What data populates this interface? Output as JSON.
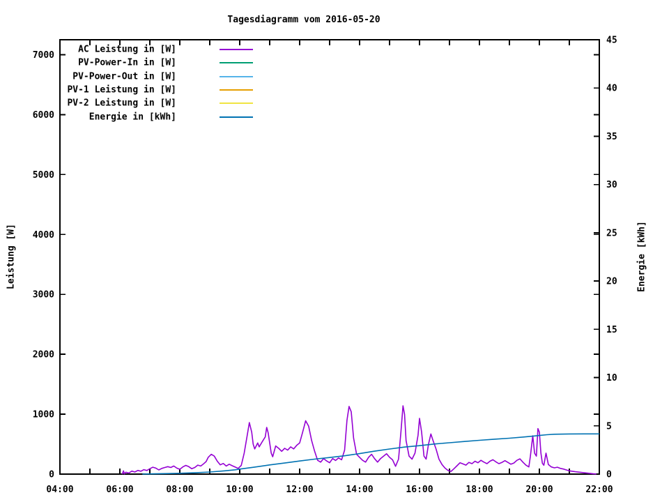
{
  "chart_data": {
    "type": "line",
    "title": "Tagesdiagramm vom 2016-05-20",
    "x_axis": {
      "start_hour": 4,
      "end_hour": 22,
      "tick_step_hours": 1,
      "label_hours": [
        4,
        6,
        8,
        10,
        12,
        14,
        16,
        18,
        20,
        22
      ],
      "labels": [
        "04:00",
        "06:00",
        "08:00",
        "10:00",
        "12:00",
        "14:00",
        "16:00",
        "18:00",
        "20:00",
        "22:00"
      ]
    },
    "y_left": {
      "label": "Leistung [W]",
      "tick_values": [
        0,
        1000,
        2000,
        3000,
        4000,
        5000,
        6000,
        7000
      ],
      "top_value": 7250
    },
    "y_right": {
      "label": "Energie [kWh]",
      "tick_values": [
        0,
        5,
        10,
        15,
        20,
        25,
        30,
        35,
        40,
        45
      ],
      "top_value": 45
    },
    "grid": false,
    "legend_position": "top-left-inside",
    "series": [
      {
        "name": "AC Leistung in [W]",
        "color": "#9400d3",
        "axis": "left",
        "points": [
          [
            6.08,
            0
          ],
          [
            6.12,
            55
          ],
          [
            6.15,
            5
          ],
          [
            6.2,
            32
          ],
          [
            6.3,
            18
          ],
          [
            6.4,
            50
          ],
          [
            6.5,
            35
          ],
          [
            6.6,
            62
          ],
          [
            6.7,
            48
          ],
          [
            6.8,
            75
          ],
          [
            6.9,
            60
          ],
          [
            7.0,
            90
          ],
          [
            7.1,
            115
          ],
          [
            7.2,
            100
          ],
          [
            7.3,
            70
          ],
          [
            7.4,
            95
          ],
          [
            7.5,
            110
          ],
          [
            7.6,
            125
          ],
          [
            7.7,
            110
          ],
          [
            7.8,
            135
          ],
          [
            7.9,
            100
          ],
          [
            8.0,
            80
          ],
          [
            8.1,
            120
          ],
          [
            8.2,
            145
          ],
          [
            8.3,
            125
          ],
          [
            8.4,
            90
          ],
          [
            8.5,
            110
          ],
          [
            8.6,
            150
          ],
          [
            8.7,
            135
          ],
          [
            8.78,
            165
          ],
          [
            8.88,
            210
          ],
          [
            8.95,
            280
          ],
          [
            9.05,
            330
          ],
          [
            9.15,
            300
          ],
          [
            9.25,
            215
          ],
          [
            9.35,
            155
          ],
          [
            9.45,
            178
          ],
          [
            9.55,
            135
          ],
          [
            9.65,
            165
          ],
          [
            9.75,
            140
          ],
          [
            9.85,
            118
          ],
          [
            9.95,
            95
          ],
          [
            10.05,
            145
          ],
          [
            10.15,
            350
          ],
          [
            10.25,
            650
          ],
          [
            10.32,
            860
          ],
          [
            10.4,
            700
          ],
          [
            10.45,
            500
          ],
          [
            10.5,
            420
          ],
          [
            10.6,
            520
          ],
          [
            10.65,
            455
          ],
          [
            10.75,
            540
          ],
          [
            10.85,
            620
          ],
          [
            10.9,
            780
          ],
          [
            10.95,
            690
          ],
          [
            11.05,
            350
          ],
          [
            11.1,
            290
          ],
          [
            11.2,
            470
          ],
          [
            11.3,
            430
          ],
          [
            11.4,
            380
          ],
          [
            11.5,
            430
          ],
          [
            11.6,
            400
          ],
          [
            11.7,
            455
          ],
          [
            11.8,
            420
          ],
          [
            11.9,
            480
          ],
          [
            12.0,
            520
          ],
          [
            12.1,
            700
          ],
          [
            12.2,
            890
          ],
          [
            12.3,
            800
          ],
          [
            12.4,
            560
          ],
          [
            12.5,
            380
          ],
          [
            12.6,
            230
          ],
          [
            12.7,
            200
          ],
          [
            12.8,
            260
          ],
          [
            12.9,
            220
          ],
          [
            13.0,
            190
          ],
          [
            13.1,
            260
          ],
          [
            13.2,
            228
          ],
          [
            13.3,
            270
          ],
          [
            13.4,
            240
          ],
          [
            13.5,
            400
          ],
          [
            13.58,
            900
          ],
          [
            13.65,
            1130
          ],
          [
            13.72,
            1040
          ],
          [
            13.8,
            600
          ],
          [
            13.9,
            330
          ],
          [
            14.0,
            280
          ],
          [
            14.1,
            230
          ],
          [
            14.2,
            200
          ],
          [
            14.3,
            280
          ],
          [
            14.4,
            330
          ],
          [
            14.5,
            258
          ],
          [
            14.6,
            200
          ],
          [
            14.7,
            260
          ],
          [
            14.8,
            300
          ],
          [
            14.9,
            340
          ],
          [
            15.0,
            280
          ],
          [
            15.1,
            238
          ],
          [
            15.2,
            130
          ],
          [
            15.3,
            250
          ],
          [
            15.38,
            700
          ],
          [
            15.45,
            1140
          ],
          [
            15.5,
            1000
          ],
          [
            15.55,
            560
          ],
          [
            15.65,
            300
          ],
          [
            15.75,
            250
          ],
          [
            15.85,
            350
          ],
          [
            15.95,
            650
          ],
          [
            16.0,
            930
          ],
          [
            16.07,
            700
          ],
          [
            16.15,
            300
          ],
          [
            16.22,
            250
          ],
          [
            16.3,
            500
          ],
          [
            16.38,
            670
          ],
          [
            16.45,
            560
          ],
          [
            16.55,
            420
          ],
          [
            16.65,
            250
          ],
          [
            16.75,
            160
          ],
          [
            16.85,
            100
          ],
          [
            16.95,
            62
          ],
          [
            17.05,
            45
          ],
          [
            17.15,
            90
          ],
          [
            17.25,
            140
          ],
          [
            17.35,
            190
          ],
          [
            17.45,
            170
          ],
          [
            17.55,
            150
          ],
          [
            17.65,
            195
          ],
          [
            17.75,
            175
          ],
          [
            17.85,
            215
          ],
          [
            17.95,
            190
          ],
          [
            18.05,
            230
          ],
          [
            18.15,
            200
          ],
          [
            18.25,
            175
          ],
          [
            18.35,
            215
          ],
          [
            18.45,
            240
          ],
          [
            18.55,
            205
          ],
          [
            18.65,
            175
          ],
          [
            18.75,
            195
          ],
          [
            18.85,
            225
          ],
          [
            18.95,
            195
          ],
          [
            19.05,
            165
          ],
          [
            19.15,
            185
          ],
          [
            19.25,
            230
          ],
          [
            19.35,
            255
          ],
          [
            19.45,
            200
          ],
          [
            19.55,
            150
          ],
          [
            19.65,
            120
          ],
          [
            19.7,
            300
          ],
          [
            19.78,
            640
          ],
          [
            19.84,
            350
          ],
          [
            19.9,
            300
          ],
          [
            19.95,
            760
          ],
          [
            20.0,
            700
          ],
          [
            20.05,
            350
          ],
          [
            20.1,
            180
          ],
          [
            20.15,
            148
          ],
          [
            20.22,
            350
          ],
          [
            20.3,
            160
          ],
          [
            20.4,
            120
          ],
          [
            20.5,
            105
          ],
          [
            20.6,
            115
          ],
          [
            20.7,
            95
          ],
          [
            20.8,
            85
          ],
          [
            20.9,
            70
          ],
          [
            21.0,
            55
          ],
          [
            21.1,
            48
          ],
          [
            21.2,
            40
          ],
          [
            21.3,
            34
          ],
          [
            21.4,
            28
          ],
          [
            21.5,
            22
          ],
          [
            21.6,
            16
          ],
          [
            21.7,
            10
          ],
          [
            21.8,
            5
          ],
          [
            21.9,
            2
          ]
        ]
      },
      {
        "name": "PV-Power-In in [W]",
        "color": "#009e73",
        "axis": "left",
        "points": []
      },
      {
        "name": "PV-Power-Out in [W]",
        "color": "#56b4e9",
        "axis": "left",
        "points": []
      },
      {
        "name": "PV-1 Leistung in [W]",
        "color": "#e69f00",
        "axis": "left",
        "points": []
      },
      {
        "name": "PV-2 Leistung in [W]",
        "color": "#f0e442",
        "axis": "left",
        "points": []
      },
      {
        "name": "Energie in [kWh]",
        "color": "#0072b2",
        "axis": "right",
        "points": [
          [
            6.75,
            0
          ],
          [
            7.0,
            0.02
          ],
          [
            7.5,
            0.05
          ],
          [
            8.0,
            0.09
          ],
          [
            8.5,
            0.14
          ],
          [
            9.0,
            0.22
          ],
          [
            9.5,
            0.34
          ],
          [
            9.85,
            0.45
          ],
          [
            10.0,
            0.52
          ],
          [
            10.5,
            0.73
          ],
          [
            11.0,
            0.95
          ],
          [
            11.5,
            1.15
          ],
          [
            12.0,
            1.36
          ],
          [
            12.5,
            1.55
          ],
          [
            13.0,
            1.72
          ],
          [
            13.5,
            1.9
          ],
          [
            14.0,
            2.12
          ],
          [
            14.5,
            2.38
          ],
          [
            15.0,
            2.6
          ],
          [
            15.5,
            2.8
          ],
          [
            16.0,
            2.95
          ],
          [
            16.5,
            3.12
          ],
          [
            17.0,
            3.25
          ],
          [
            17.5,
            3.38
          ],
          [
            18.0,
            3.5
          ],
          [
            18.5,
            3.62
          ],
          [
            19.0,
            3.72
          ],
          [
            19.5,
            3.85
          ],
          [
            20.0,
            4.0
          ],
          [
            20.25,
            4.08
          ],
          [
            20.5,
            4.13
          ],
          [
            21.0,
            4.16
          ],
          [
            21.5,
            4.17
          ],
          [
            22.0,
            4.17
          ]
        ]
      }
    ]
  }
}
